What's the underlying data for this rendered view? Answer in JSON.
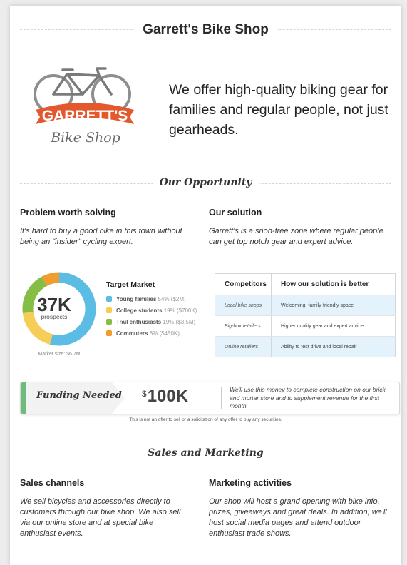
{
  "header": {
    "title": "Garrett's Bike Shop",
    "tagline": "We offer high-quality biking gear for families and regular people, not just gearheads."
  },
  "logo": {
    "line1": "GARRETT'S",
    "line2": "Bike Shop",
    "banner_color": "#e4582e"
  },
  "opportunity": {
    "section_title": "Our Opportunity",
    "problem_title": "Problem worth solving",
    "problem_text": "It's hard to buy a good bike in this town without being an \"insider\" cycling expert.",
    "solution_title": "Our solution",
    "solution_text": "Garrett's is a snob-free zone where regular people can get top notch gear and expert advice."
  },
  "target_market": {
    "title": "Target Market",
    "total": "37K",
    "total_label": "prospects",
    "market_size": "Market size: $6.7M",
    "segments": [
      {
        "name": "Young families",
        "detail": "54% ($2M)",
        "percent": 54,
        "color": "#5bbde4"
      },
      {
        "name": "College students",
        "detail": "19% ($700K)",
        "percent": 19,
        "color": "#f6ce55"
      },
      {
        "name": "Trail enthusiasts",
        "detail": "19% ($3.5M)",
        "percent": 19,
        "color": "#86bd45"
      },
      {
        "name": "Commuters",
        "detail": "8% ($450K)",
        "percent": 8,
        "color": "#ef9d2f"
      }
    ]
  },
  "competitors": {
    "header_left": "Competitors",
    "header_right": "How our solution is better",
    "rows": [
      {
        "competitor": "Local bike shops",
        "advantage": "Welcoming, family-friendly space"
      },
      {
        "competitor": "Big-box retailers",
        "advantage": "Higher quality gear and expert advice"
      },
      {
        "competitor": "Online retailers",
        "advantage": "Ability to test drive and local repair"
      }
    ]
  },
  "funding": {
    "label": "Funding Needed",
    "currency": "$",
    "amount": "100K",
    "description": "We'll use this money to complete construction on our brick and mortar store and to supplement revenue for the first month.",
    "accent_color": "#6dbb7d",
    "disclaimer": "This is not an offer to sell or a solicitation of any offer to buy any securities."
  },
  "sales": {
    "section_title": "Sales and Marketing",
    "channels_title": "Sales channels",
    "channels_text": "We sell bicycles and accessories directly to customers through our bike shop. We also sell via our online store and at special bike enthusiast events.",
    "marketing_title": "Marketing activities",
    "marketing_text": "Our shop will host a grand opening with bike info, prizes, giveaways and great deals. In addition, we'll host social media pages and attend outdoor enthusiast trade shows."
  }
}
